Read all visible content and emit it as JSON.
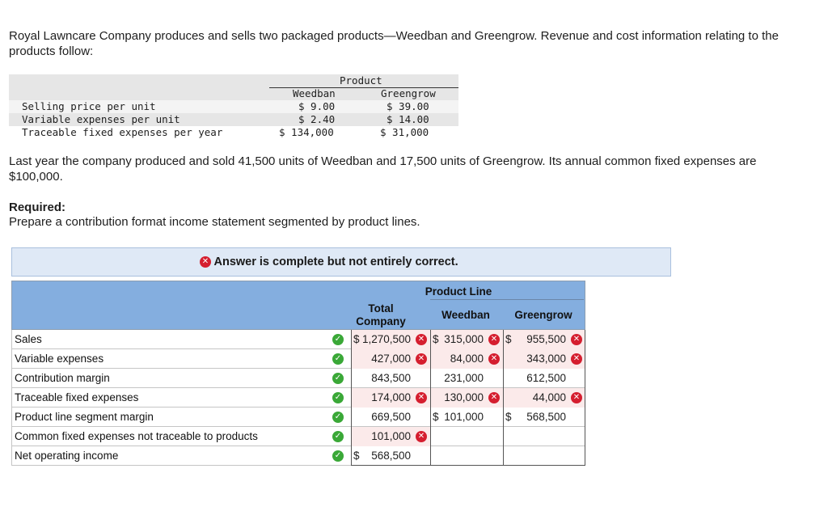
{
  "intro": "Royal Lawncare Company produces and sells two packaged products—Weedban and Greengrow. Revenue and cost information relating to the products follow:",
  "product_table": {
    "group_header": "Product",
    "columns": [
      "Weedban",
      "Greengrow"
    ],
    "rows": [
      {
        "label": "Selling price per unit",
        "weedban": "$ 9.00",
        "greengrow": "$ 39.00"
      },
      {
        "label": "Variable expenses per unit",
        "weedban": "$ 2.40",
        "greengrow": "$ 14.00"
      },
      {
        "label": "Traceable fixed expenses per year",
        "weedban": "$ 134,000",
        "greengrow": "$ 31,000"
      }
    ]
  },
  "paragraph2": "Last year the company produced and sold 41,500 units of Weedban and 17,500 units of Greengrow. Its annual common fixed expenses are $100,000.",
  "required_label": "Required:",
  "required_text": "Prepare a contribution format income statement segmented by product lines.",
  "banner": "Answer is complete but not entirely correct.",
  "statement": {
    "header_group": "Product Line",
    "col_total": "Total Company",
    "col_weedban": "Weedban",
    "col_greengrow": "Greengrow",
    "rows": [
      {
        "label": "Sales",
        "total": "1,270,500",
        "total_dollar": "$",
        "total_wrong": true,
        "weedban": "315,000",
        "weedban_dollar": "$",
        "weedban_wrong": true,
        "greengrow": "955,500",
        "greengrow_dollar": "$",
        "greengrow_wrong": true
      },
      {
        "label": "Variable expenses",
        "total": "427,000",
        "total_dollar": "",
        "total_wrong": true,
        "weedban": "84,000",
        "weedban_dollar": "",
        "weedban_wrong": true,
        "greengrow": "343,000",
        "greengrow_dollar": "",
        "greengrow_wrong": true
      },
      {
        "label": "Contribution margin",
        "total": "843,500",
        "total_dollar": "",
        "total_wrong": false,
        "weedban": "231,000",
        "weedban_dollar": "",
        "weedban_wrong": false,
        "greengrow": "612,500",
        "greengrow_dollar": "",
        "greengrow_wrong": false
      },
      {
        "label": "Traceable fixed expenses",
        "total": "174,000",
        "total_dollar": "",
        "total_wrong": true,
        "weedban": "130,000",
        "weedban_dollar": "",
        "weedban_wrong": true,
        "greengrow": "44,000",
        "greengrow_dollar": "",
        "greengrow_wrong": true
      },
      {
        "label": "Product line segment margin",
        "total": "669,500",
        "total_dollar": "",
        "total_wrong": false,
        "weedban": "101,000",
        "weedban_dollar": "$",
        "weedban_wrong": false,
        "greengrow": "568,500",
        "greengrow_dollar": "$",
        "greengrow_wrong": false
      },
      {
        "label": "Common fixed expenses not traceable to products",
        "total": "101,000",
        "total_dollar": "",
        "total_wrong": true,
        "weedban": "",
        "weedban_dollar": "",
        "weedban_wrong": false,
        "greengrow": "",
        "greengrow_dollar": "",
        "greengrow_wrong": false
      },
      {
        "label": "Net operating income",
        "total": "568,500",
        "total_dollar": "$",
        "total_wrong": false,
        "weedban": "",
        "weedban_dollar": "",
        "weedban_wrong": false,
        "greengrow": "",
        "greengrow_dollar": "",
        "greengrow_wrong": false
      }
    ]
  },
  "colors": {
    "header_blue": "#84aedf",
    "banner_bg": "#dfe9f6",
    "error_red": "#d51e2f",
    "check_green": "#3aa837",
    "error_cell": "#fbeaea"
  },
  "icons": {
    "wrong": "x-circle-icon",
    "correct": "check-circle-icon"
  }
}
